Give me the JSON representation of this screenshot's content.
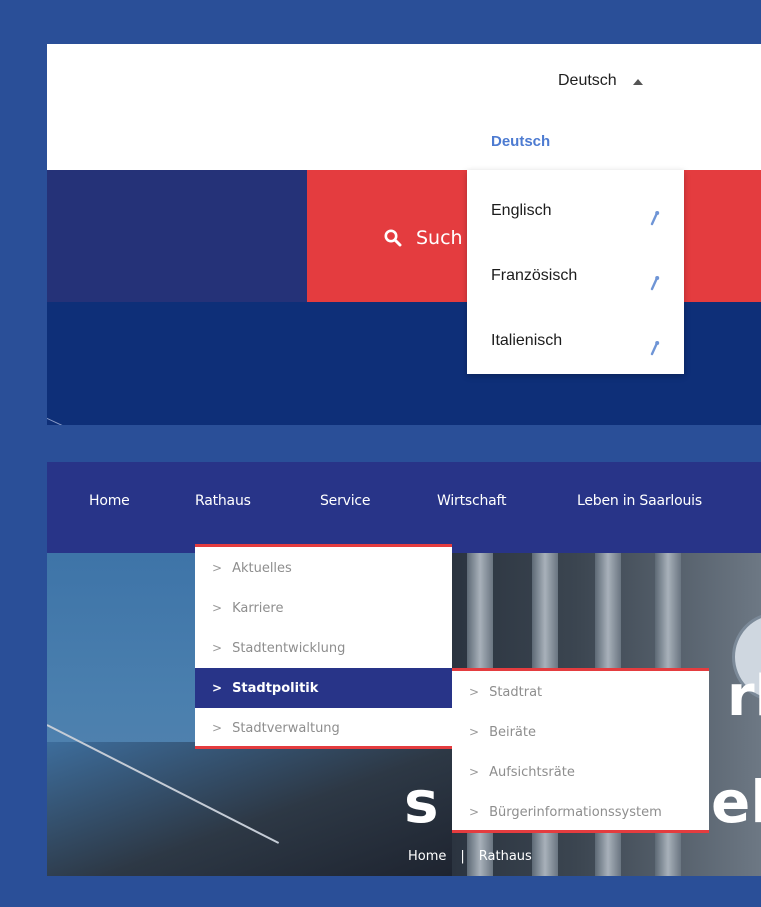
{
  "language": {
    "current": "Deutsch",
    "options": [
      {
        "label": "Deutsch",
        "active": true
      },
      {
        "label": "Englisch",
        "external": true
      },
      {
        "label": "Französisch",
        "external": true
      },
      {
        "label": "Italienisch",
        "external": true
      }
    ]
  },
  "search": {
    "label": "Such"
  },
  "nav": {
    "items": [
      "Home",
      "Rathaus",
      "Service",
      "Wirtschaft",
      "Leben in Saarlouis"
    ]
  },
  "submenu_rathaus": {
    "items": [
      "Aktuelles",
      "Karriere",
      "Stadtentwicklung",
      "Stadtpolitik",
      "Stadtverwaltung"
    ],
    "active": "Stadtpolitik"
  },
  "submenu_stadtpolitik": {
    "items": [
      "Stadtrat",
      "Beiräte",
      "Aufsichtsräte",
      "Bürgerinformationssystem"
    ]
  },
  "hero": {
    "title_fragments": [
      "rl",
      "s",
      "eb"
    ]
  },
  "breadcrumb": {
    "items": [
      "Home",
      "Rathaus"
    ],
    "separator": "|"
  },
  "colors": {
    "frame": "#2a4f98",
    "nav": "#283488",
    "accent_red": "#e43c3f",
    "link_blue": "#4d7bd1"
  },
  "icons": {
    "search": "search-icon",
    "caret": "caret-up-icon",
    "external": "external-link-icon",
    "chevron": "chevron-right-icon"
  }
}
